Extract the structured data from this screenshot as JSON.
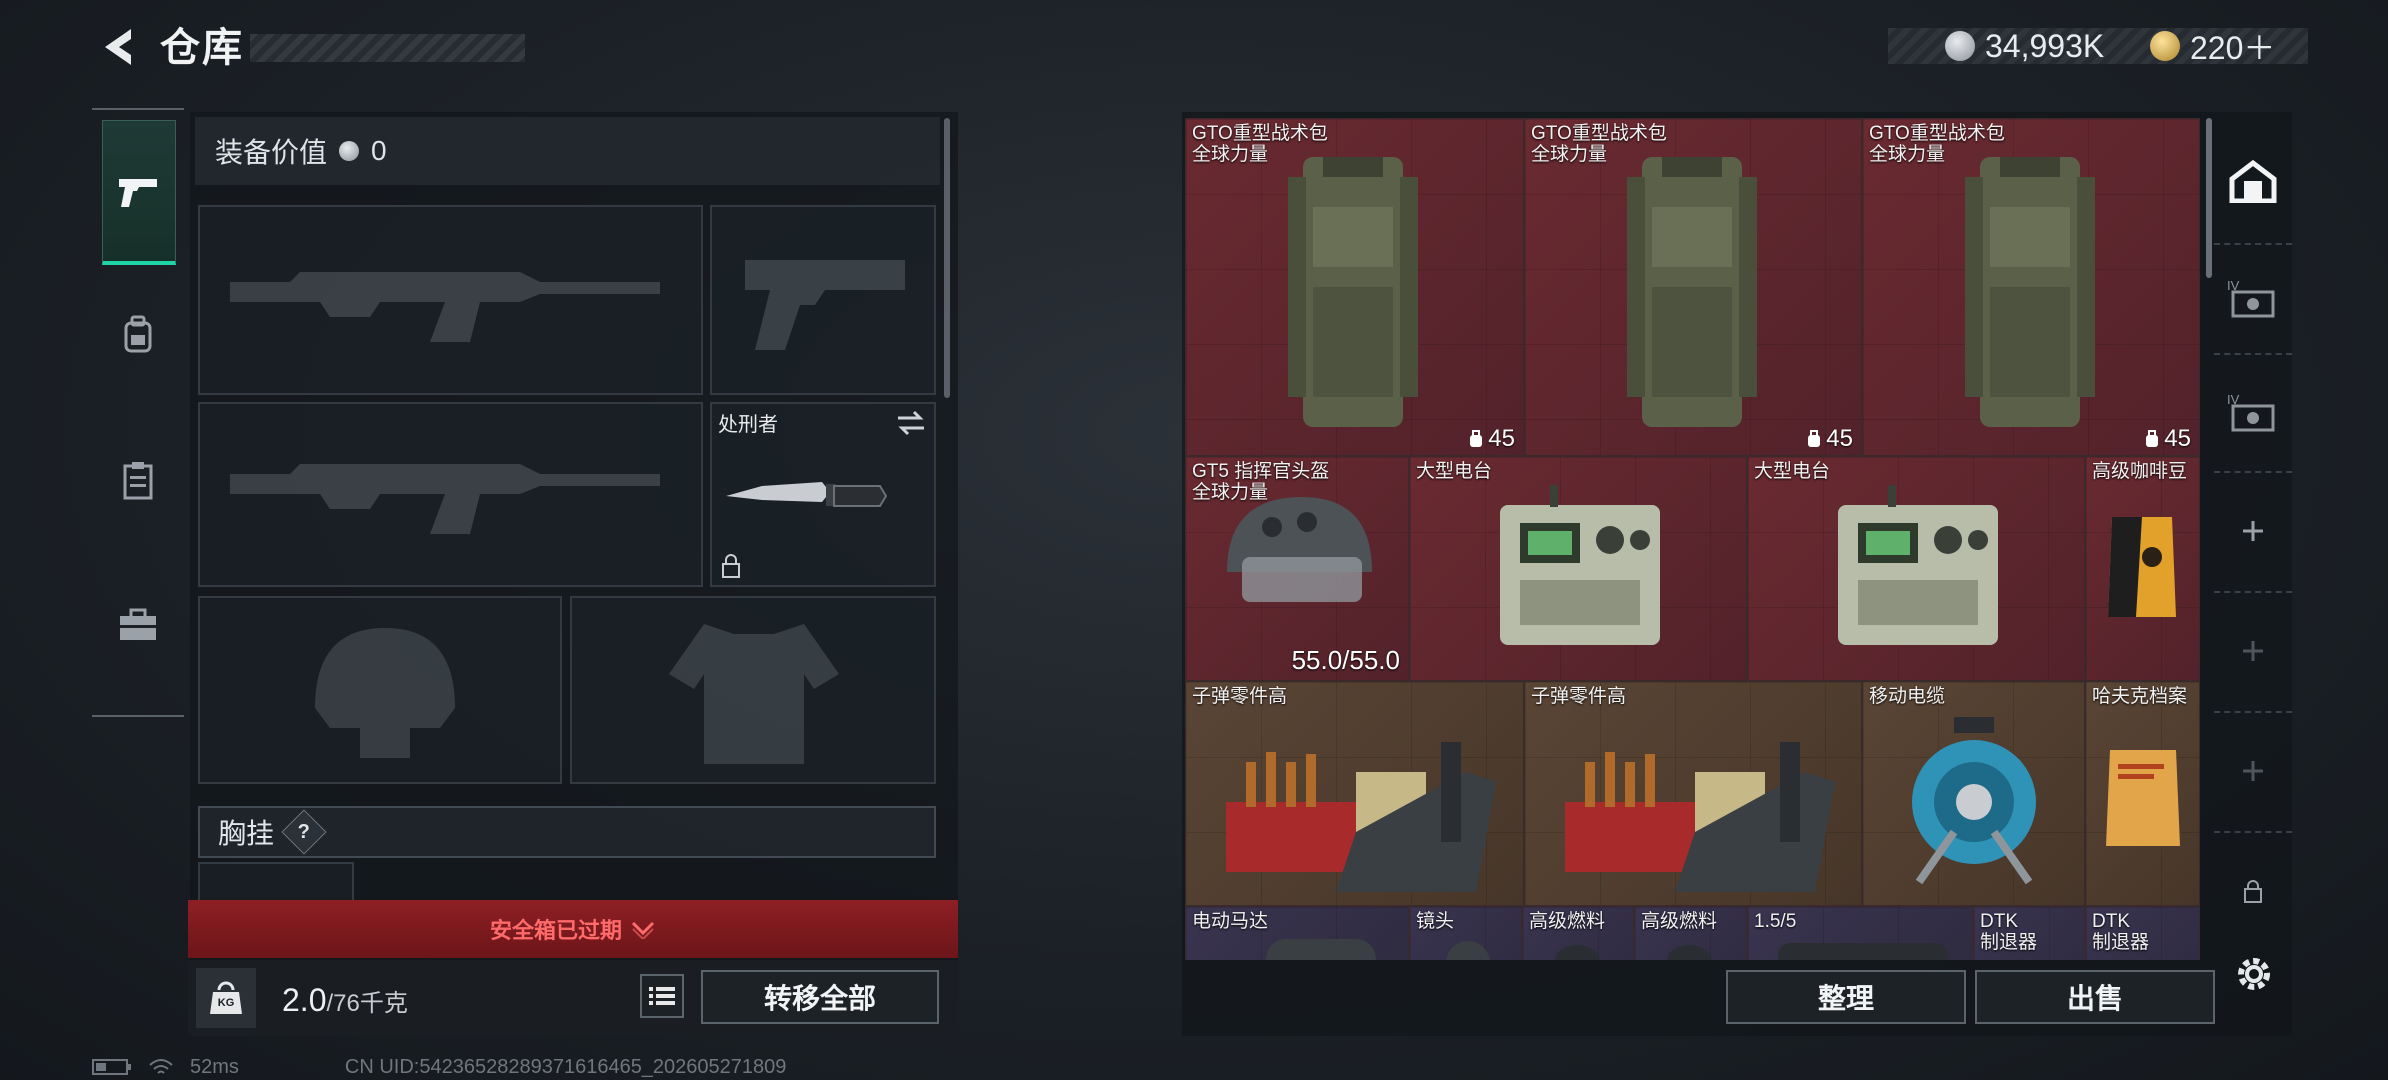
{
  "header": {
    "title": "仓库",
    "currency_silver": "34,993K",
    "currency_gold": "220＋",
    "colors": {
      "silver": "#b9bec4",
      "gold": "#d8b35a"
    }
  },
  "left_nav": {
    "items": [
      {
        "icon": "pistol-icon",
        "active": true
      },
      {
        "icon": "backpack-icon",
        "active": false
      },
      {
        "icon": "clipboard-icon",
        "active": false
      },
      {
        "icon": "toolbox-icon",
        "active": false
      }
    ]
  },
  "equipment": {
    "value_label": "装备价值",
    "value": "0",
    "melee_name": "处刑者",
    "chest_rig_label": "胸挂",
    "chest_rig_help": "?",
    "safebox_status": "安全箱已过期",
    "weight_current": "2.0",
    "weight_max_unit": "/76千克",
    "weight_icon_label": "KG",
    "transfer_all": "转移全部"
  },
  "stash": {
    "items": [
      {
        "name": "GTO重型战术包\n全球力量",
        "count": "45",
        "rarity": "red"
      },
      {
        "name": "GTO重型战术包\n全球力量",
        "count": "45",
        "rarity": "red"
      },
      {
        "name": "GTO重型战术包\n全球力量",
        "count": "45",
        "rarity": "red"
      },
      {
        "name": "GT5 指挥官头盔\n全球力量",
        "durability": "55.0/55.0",
        "rarity": "red"
      },
      {
        "name": "大型电台",
        "rarity": "red"
      },
      {
        "name": "大型电台",
        "rarity": "red"
      },
      {
        "name": "高级咖啡豆",
        "rarity": "red"
      },
      {
        "name": "子弹零件高",
        "rarity": "gold"
      },
      {
        "name": "子弹零件高",
        "rarity": "gold"
      },
      {
        "name": "移动电缆",
        "rarity": "gold"
      },
      {
        "name": "哈夫克档案",
        "rarity": "gold"
      },
      {
        "name": "电动马达",
        "rarity": "purple"
      },
      {
        "name": "镜头",
        "rarity": "purple"
      },
      {
        "name": "高级燃料",
        "rarity": "purple"
      },
      {
        "name": "高级燃料",
        "rarity": "purple"
      },
      {
        "name": "1.5/5",
        "rarity": "purple"
      },
      {
        "name": "DTK\n制退器",
        "rarity": "purple"
      },
      {
        "name": "DTK\n制退器",
        "rarity": "purple"
      }
    ],
    "sort_button": "整理",
    "sell_button": "出售"
  },
  "right_nav": {
    "items": [
      "home-base-icon",
      "tier-iv-item-icon",
      "tier-iv-item-icon",
      "add-icon",
      "add-icon",
      "add-icon",
      "lock-icon"
    ]
  },
  "status_bar": {
    "ping": "52ms",
    "uid": "CN UID:5423652828937161646​5_202605271809"
  }
}
